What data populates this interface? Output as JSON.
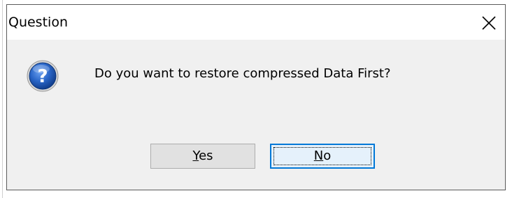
{
  "window": {
    "title": "Question",
    "close_icon": "close-icon"
  },
  "dialog": {
    "icon": "question-icon",
    "message": "Do you want to restore compressed Data First?"
  },
  "buttons": {
    "yes": {
      "mnemonic": "Y",
      "rest": "es"
    },
    "no": {
      "mnemonic": "N",
      "rest": "o",
      "focused": true
    }
  },
  "colors": {
    "accent": "#0078d7",
    "dialog_bg": "#f0f0f0",
    "icon_blue": "#1c5ab8"
  }
}
